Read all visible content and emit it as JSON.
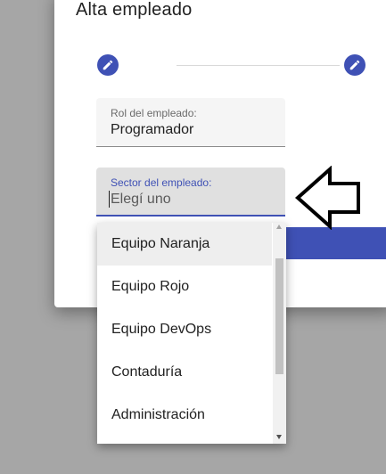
{
  "dialog": {
    "title": "Alta empleado"
  },
  "stepper": {
    "steps": [
      {
        "icon": "edit-icon"
      },
      {
        "icon": "edit-icon"
      }
    ]
  },
  "role_field": {
    "label": "Rol del empleado:",
    "value": "Programador"
  },
  "sector_field": {
    "label": "Sector del empleado:",
    "placeholder": "Elegí uno",
    "focused": true
  },
  "dropdown": {
    "options": [
      "Equipo Naranja",
      "Equipo Rojo",
      "Equipo DevOps",
      "Contaduría",
      "Administración"
    ],
    "highlighted_index": 0
  },
  "colors": {
    "primary": "#3f51b5",
    "backdrop": "#a6a6a6"
  },
  "annotation": {
    "icon": "left-arrow-icon"
  }
}
